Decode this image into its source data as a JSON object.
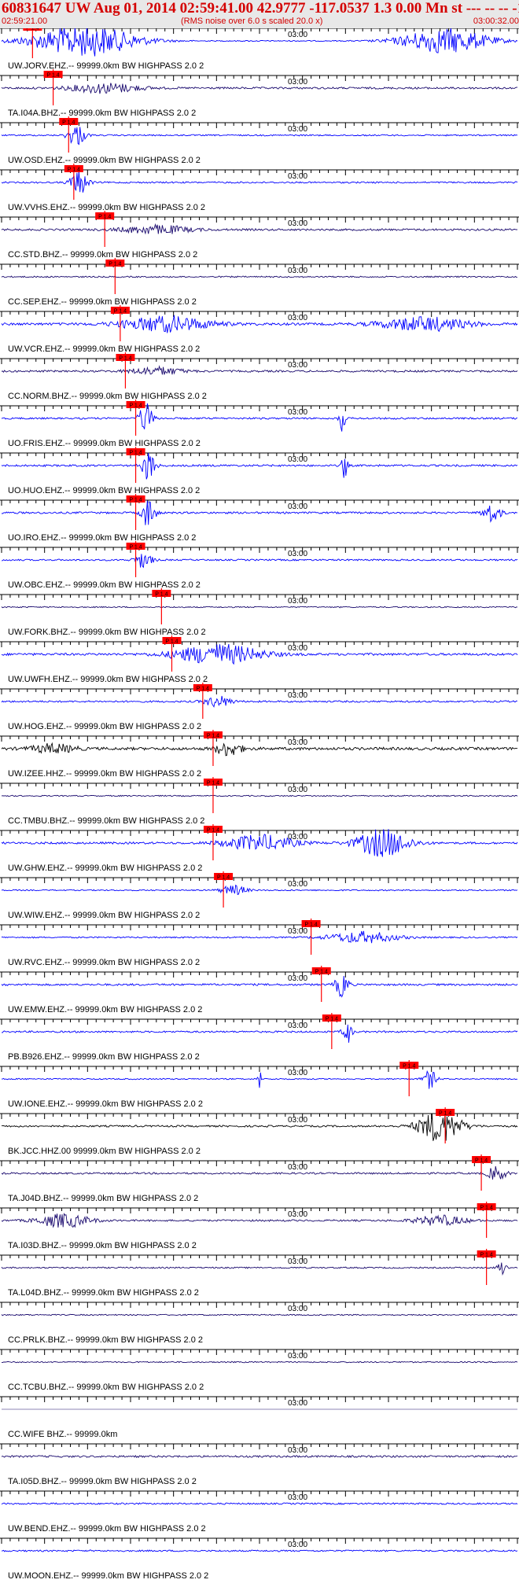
{
  "header": {
    "title": "60831647 UW Aug 01, 2014 02:59:41.00   42.9777 -117.0537   1.3 0.00 Mn st --- -- --   -1",
    "start_time": "02:59:21.00",
    "note": "(RMS noise over 6.0 s scaled 20.0 x)",
    "end_time": "03:00:32.00"
  },
  "chart_data": {
    "type": "line",
    "title": "60831647 UW Aug 01, 2014 02:59:41.00   42.9777 -117.0537   1.3 0.00 Mn st --- -- --   -1",
    "xlabel": "",
    "ylabel": "",
    "time_start": "02:59:21.00",
    "time_end": "03:00:32.00",
    "tick_label": "03:00",
    "pick_label": "P 1.4",
    "colors": {
      "blue": "#0000ff",
      "navy": "#1a0a6e",
      "black": "#000000",
      "pick": "#ff0000"
    },
    "traces": [
      {
        "label": "UW.JORV.EHZ.-- 99999.0km BW HIGHPASS  2.0  2",
        "color": "blue",
        "noise": 0.3,
        "pick": 0.06,
        "bursts": [
          [
            0.16,
            0.12,
            5.0
          ],
          [
            0.86,
            0.1,
            4.0
          ]
        ]
      },
      {
        "label": "TA.I04A.BHZ.-- 99999.0km BW HIGHPASS  2.0  2",
        "color": "navy",
        "noise": 0.55,
        "pick": 0.1,
        "bursts": [
          [
            0.2,
            0.08,
            1.6
          ]
        ]
      },
      {
        "label": "UW.OSD.EHZ.-- 99999.0km BW HIGHPASS  2.0  2",
        "color": "blue",
        "noise": 0.4,
        "pick": 0.13,
        "bursts": [
          [
            0.145,
            0.02,
            3.5
          ]
        ]
      },
      {
        "label": "UW.VVHS.EHZ.-- 99999.0km BW HIGHPASS  2.0  2",
        "color": "blue",
        "noise": 0.45,
        "pick": 0.14,
        "bursts": [
          [
            0.15,
            0.02,
            4.0
          ]
        ]
      },
      {
        "label": "CC.STD.BHZ.-- 99999.0km BW HIGHPASS  2.0  2",
        "color": "navy",
        "noise": 0.55,
        "pick": 0.2,
        "bursts": [
          [
            0.3,
            0.08,
            1.4
          ]
        ]
      },
      {
        "label": "CC.SEP.EHZ.-- 99999.0km BW HIGHPASS  2.0  2",
        "color": "navy",
        "noise": 0.4,
        "pick": 0.22,
        "bursts": []
      },
      {
        "label": "UW.VCR.EHZ.-- 99999.0km BW HIGHPASS  2.0  2",
        "color": "blue",
        "noise": 0.7,
        "pick": 0.23,
        "bursts": [
          [
            0.32,
            0.1,
            2.5
          ],
          [
            0.82,
            0.1,
            2.2
          ]
        ]
      },
      {
        "label": "CC.NORM.BHZ.-- 99999.0km BW HIGHPASS  2.0  2",
        "color": "navy",
        "noise": 0.55,
        "pick": 0.24,
        "bursts": [
          [
            0.3,
            0.06,
            1.3
          ]
        ]
      },
      {
        "label": "UO.FRIS.EHZ.-- 99999.0km BW HIGHPASS  2.0  2",
        "color": "blue",
        "noise": 0.5,
        "pick": 0.26,
        "bursts": [
          [
            0.28,
            0.015,
            5.0
          ],
          [
            0.66,
            0.006,
            6.0
          ]
        ]
      },
      {
        "label": "UO.HUO.EHZ.-- 99999.0km BW HIGHPASS  2.0  2",
        "color": "blue",
        "noise": 0.55,
        "pick": 0.26,
        "bursts": [
          [
            0.285,
            0.015,
            5.0
          ],
          [
            0.665,
            0.006,
            5.0
          ]
        ]
      },
      {
        "label": "UO.IRO.EHZ.-- 99999.0km BW HIGHPASS  2.0  2",
        "color": "blue",
        "noise": 0.55,
        "pick": 0.26,
        "bursts": [
          [
            0.285,
            0.015,
            5.0
          ],
          [
            0.95,
            0.02,
            3.0
          ]
        ]
      },
      {
        "label": "UW.OBC.EHZ.-- 99999.0km BW HIGHPASS  2.0  2",
        "color": "blue",
        "noise": 0.45,
        "pick": 0.26,
        "bursts": [
          [
            0.275,
            0.02,
            2.5
          ]
        ]
      },
      {
        "label": "UW.FORK.BHZ.-- 99999.0km BW HIGHPASS  2.0  2",
        "color": "navy",
        "noise": 0.35,
        "pick": 0.31,
        "bursts": []
      },
      {
        "label": "UW.UWFH.EHZ.-- 99999.0km BW HIGHPASS  2.0  2",
        "color": "blue",
        "noise": 0.65,
        "pick": 0.33,
        "bursts": [
          [
            0.42,
            0.1,
            3.2
          ]
        ]
      },
      {
        "label": "UW.HOG.EHZ.-- 99999.0km BW HIGHPASS  2.0  2",
        "color": "blue",
        "noise": 0.5,
        "pick": 0.39,
        "bursts": [
          [
            0.42,
            0.03,
            1.8
          ]
        ]
      },
      {
        "label": "UW.IZEE.HHZ.-- 99999.0km BW HIGHPASS  2.0  2",
        "color": "black",
        "noise": 0.8,
        "pick": 0.41,
        "bursts": [
          [
            0.44,
            0.03,
            2.2
          ],
          [
            0.1,
            0.05,
            1.4
          ]
        ]
      },
      {
        "label": "CC.TMBU.BHZ.-- 99999.0km BW HIGHPASS  2.0  2",
        "color": "navy",
        "noise": 0.35,
        "pick": 0.41,
        "bursts": []
      },
      {
        "label": "UW.GHW.EHZ.-- 99999.0km BW HIGHPASS  2.0  2",
        "color": "blue",
        "noise": 0.6,
        "pick": 0.41,
        "bursts": [
          [
            0.5,
            0.08,
            2.5
          ],
          [
            0.74,
            0.06,
            4.5
          ]
        ]
      },
      {
        "label": "UW.WIW.EHZ.-- 99999.0km BW HIGHPASS  2.0  2",
        "color": "blue",
        "noise": 0.35,
        "pick": 0.43,
        "bursts": [
          [
            0.45,
            0.03,
            1.6
          ]
        ]
      },
      {
        "label": "UW.RVC.EHZ.-- 99999.0km BW HIGHPASS  2.0  2",
        "color": "blue",
        "noise": 0.4,
        "pick": 0.6,
        "bursts": [
          [
            0.7,
            0.08,
            1.8
          ]
        ]
      },
      {
        "label": "UW.EMW.EHZ.-- 99999.0km BW HIGHPASS  2.0  2",
        "color": "blue",
        "noise": 0.55,
        "pick": 0.62,
        "bursts": [
          [
            0.66,
            0.015,
            4.0
          ]
        ]
      },
      {
        "label": "PB.B926.EHZ.-- 99999.0km BW HIGHPASS  2.0  2",
        "color": "blue",
        "noise": 0.5,
        "pick": 0.64,
        "bursts": [
          [
            0.67,
            0.01,
            4.0
          ]
        ]
      },
      {
        "label": "UW.IONE.EHZ.-- 99999.0km BW HIGHPASS  2.0  2",
        "color": "blue",
        "noise": 0.35,
        "pick": 0.79,
        "bursts": [
          [
            0.5,
            0.004,
            4.0
          ],
          [
            0.83,
            0.015,
            3.0
          ]
        ]
      },
      {
        "label": "BK.JCC.HHZ.00 99999.0km BW HIGHPASS  2.0  2",
        "color": "black",
        "noise": 0.5,
        "pick": 0.86,
        "bursts": [
          [
            0.85,
            0.05,
            5.0
          ]
        ]
      },
      {
        "label": "TA.J04D.BHZ.-- 99999.0km BW HIGHPASS  2.0  2",
        "color": "navy",
        "noise": 0.5,
        "pick": 0.93,
        "bursts": [
          [
            0.96,
            0.02,
            2.5
          ]
        ]
      },
      {
        "label": "TA.I03D.BHZ.-- 99999.0km BW HIGHPASS  2.0  2",
        "color": "navy",
        "noise": 0.5,
        "pick": 0.94,
        "bursts": [
          [
            0.12,
            0.06,
            2.2
          ],
          [
            0.85,
            0.06,
            1.6
          ]
        ]
      },
      {
        "label": "TA.L04D.BHZ.-- 99999.0km BW HIGHPASS  2.0  2",
        "color": "navy",
        "noise": 0.4,
        "pick": 0.94,
        "bursts": [
          [
            0.97,
            0.01,
            2.5
          ]
        ]
      },
      {
        "label": "CC.PRLK.BHZ.-- 99999.0km BW HIGHPASS  2.0  2",
        "color": "navy",
        "noise": 0.35,
        "pick": null,
        "bursts": []
      },
      {
        "label": "CC.TCBU.BHZ.-- 99999.0km BW HIGHPASS  2.0  2",
        "color": "navy",
        "noise": 0.35,
        "pick": null,
        "bursts": []
      },
      {
        "label": "CC.WIFE BHZ.-- 99999.0km",
        "color": "navy",
        "noise": 0.0,
        "pick": null,
        "bursts": []
      },
      {
        "label": "TA.I05D.BHZ.-- 99999.0km BW HIGHPASS  2.0  2",
        "color": "navy",
        "noise": 0.55,
        "pick": null,
        "bursts": []
      },
      {
        "label": "UW.BEND.EHZ.-- 99999.0km BW HIGHPASS  2.0  2",
        "color": "blue",
        "noise": 0.45,
        "pick": null,
        "bursts": []
      },
      {
        "label": "UW.MOON.EHZ.-- 99999.0km BW HIGHPASS  2.0  2",
        "color": "blue",
        "noise": 0.45,
        "pick": null,
        "bursts": []
      }
    ]
  }
}
